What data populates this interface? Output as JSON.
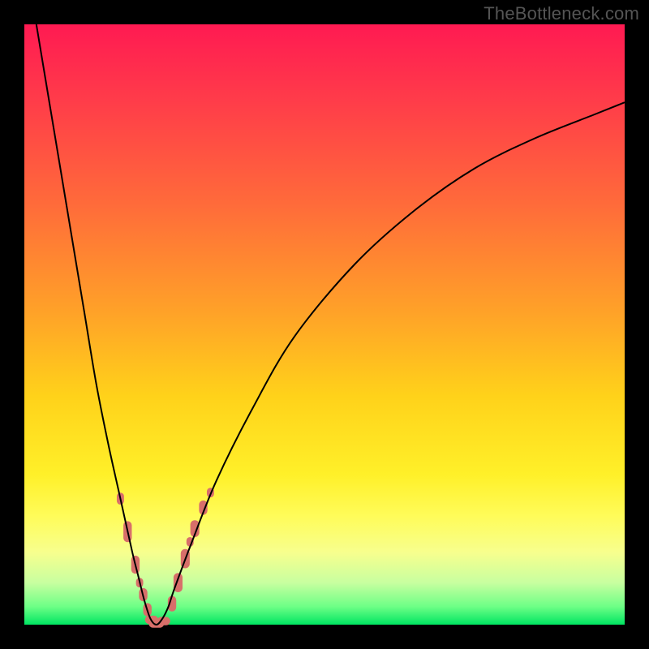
{
  "watermark": "TheBottleneck.com",
  "chart_data": {
    "type": "line",
    "title": "",
    "xlabel": "",
    "ylabel": "",
    "xlim": [
      0,
      100
    ],
    "ylim": [
      0,
      100
    ],
    "grid": false,
    "series": [
      {
        "name": "bottleneck-curve",
        "x": [
          2,
          4,
          6,
          8,
          10,
          12,
          14,
          16,
          18,
          19,
          20,
          21,
          22,
          23,
          24,
          25,
          28,
          32,
          38,
          45,
          55,
          65,
          75,
          85,
          95,
          100
        ],
        "y": [
          100,
          88,
          76,
          64,
          52,
          40,
          30,
          21,
          12,
          8,
          4,
          1,
          0,
          1,
          3,
          6,
          14,
          24,
          36,
          48,
          60,
          69,
          76,
          81,
          85,
          87
        ],
        "color": "#000000",
        "stroke_width": 2
      }
    ],
    "markers": [
      {
        "name": "highlight-points-left",
        "shape": "pill",
        "color": "#d86f6a",
        "points": [
          {
            "x": 16.0,
            "y": 21.0,
            "w": 1.2,
            "h": 2.0
          },
          {
            "x": 17.2,
            "y": 15.5,
            "w": 1.4,
            "h": 3.5
          },
          {
            "x": 18.5,
            "y": 10.0,
            "w": 1.4,
            "h": 3.0
          },
          {
            "x": 19.2,
            "y": 7.0,
            "w": 1.2,
            "h": 1.6
          },
          {
            "x": 19.8,
            "y": 5.0,
            "w": 1.4,
            "h": 2.2
          },
          {
            "x": 20.5,
            "y": 2.5,
            "w": 1.4,
            "h": 2.2
          },
          {
            "x": 21.2,
            "y": 0.8,
            "w": 2.2,
            "h": 1.4
          },
          {
            "x": 22.0,
            "y": 0.2,
            "w": 2.6,
            "h": 1.4
          },
          {
            "x": 23.2,
            "y": 0.6,
            "w": 2.2,
            "h": 1.4
          }
        ]
      },
      {
        "name": "highlight-points-right",
        "shape": "pill",
        "color": "#d86f6a",
        "points": [
          {
            "x": 24.6,
            "y": 3.5,
            "w": 1.4,
            "h": 2.6
          },
          {
            "x": 25.6,
            "y": 7.0,
            "w": 1.5,
            "h": 3.2
          },
          {
            "x": 26.8,
            "y": 11.0,
            "w": 1.5,
            "h": 3.2
          },
          {
            "x": 27.6,
            "y": 13.8,
            "w": 1.2,
            "h": 1.6
          },
          {
            "x": 28.4,
            "y": 16.0,
            "w": 1.5,
            "h": 2.8
          },
          {
            "x": 29.8,
            "y": 19.5,
            "w": 1.4,
            "h": 2.4
          },
          {
            "x": 31.0,
            "y": 22.0,
            "w": 1.2,
            "h": 1.6
          }
        ]
      }
    ]
  }
}
